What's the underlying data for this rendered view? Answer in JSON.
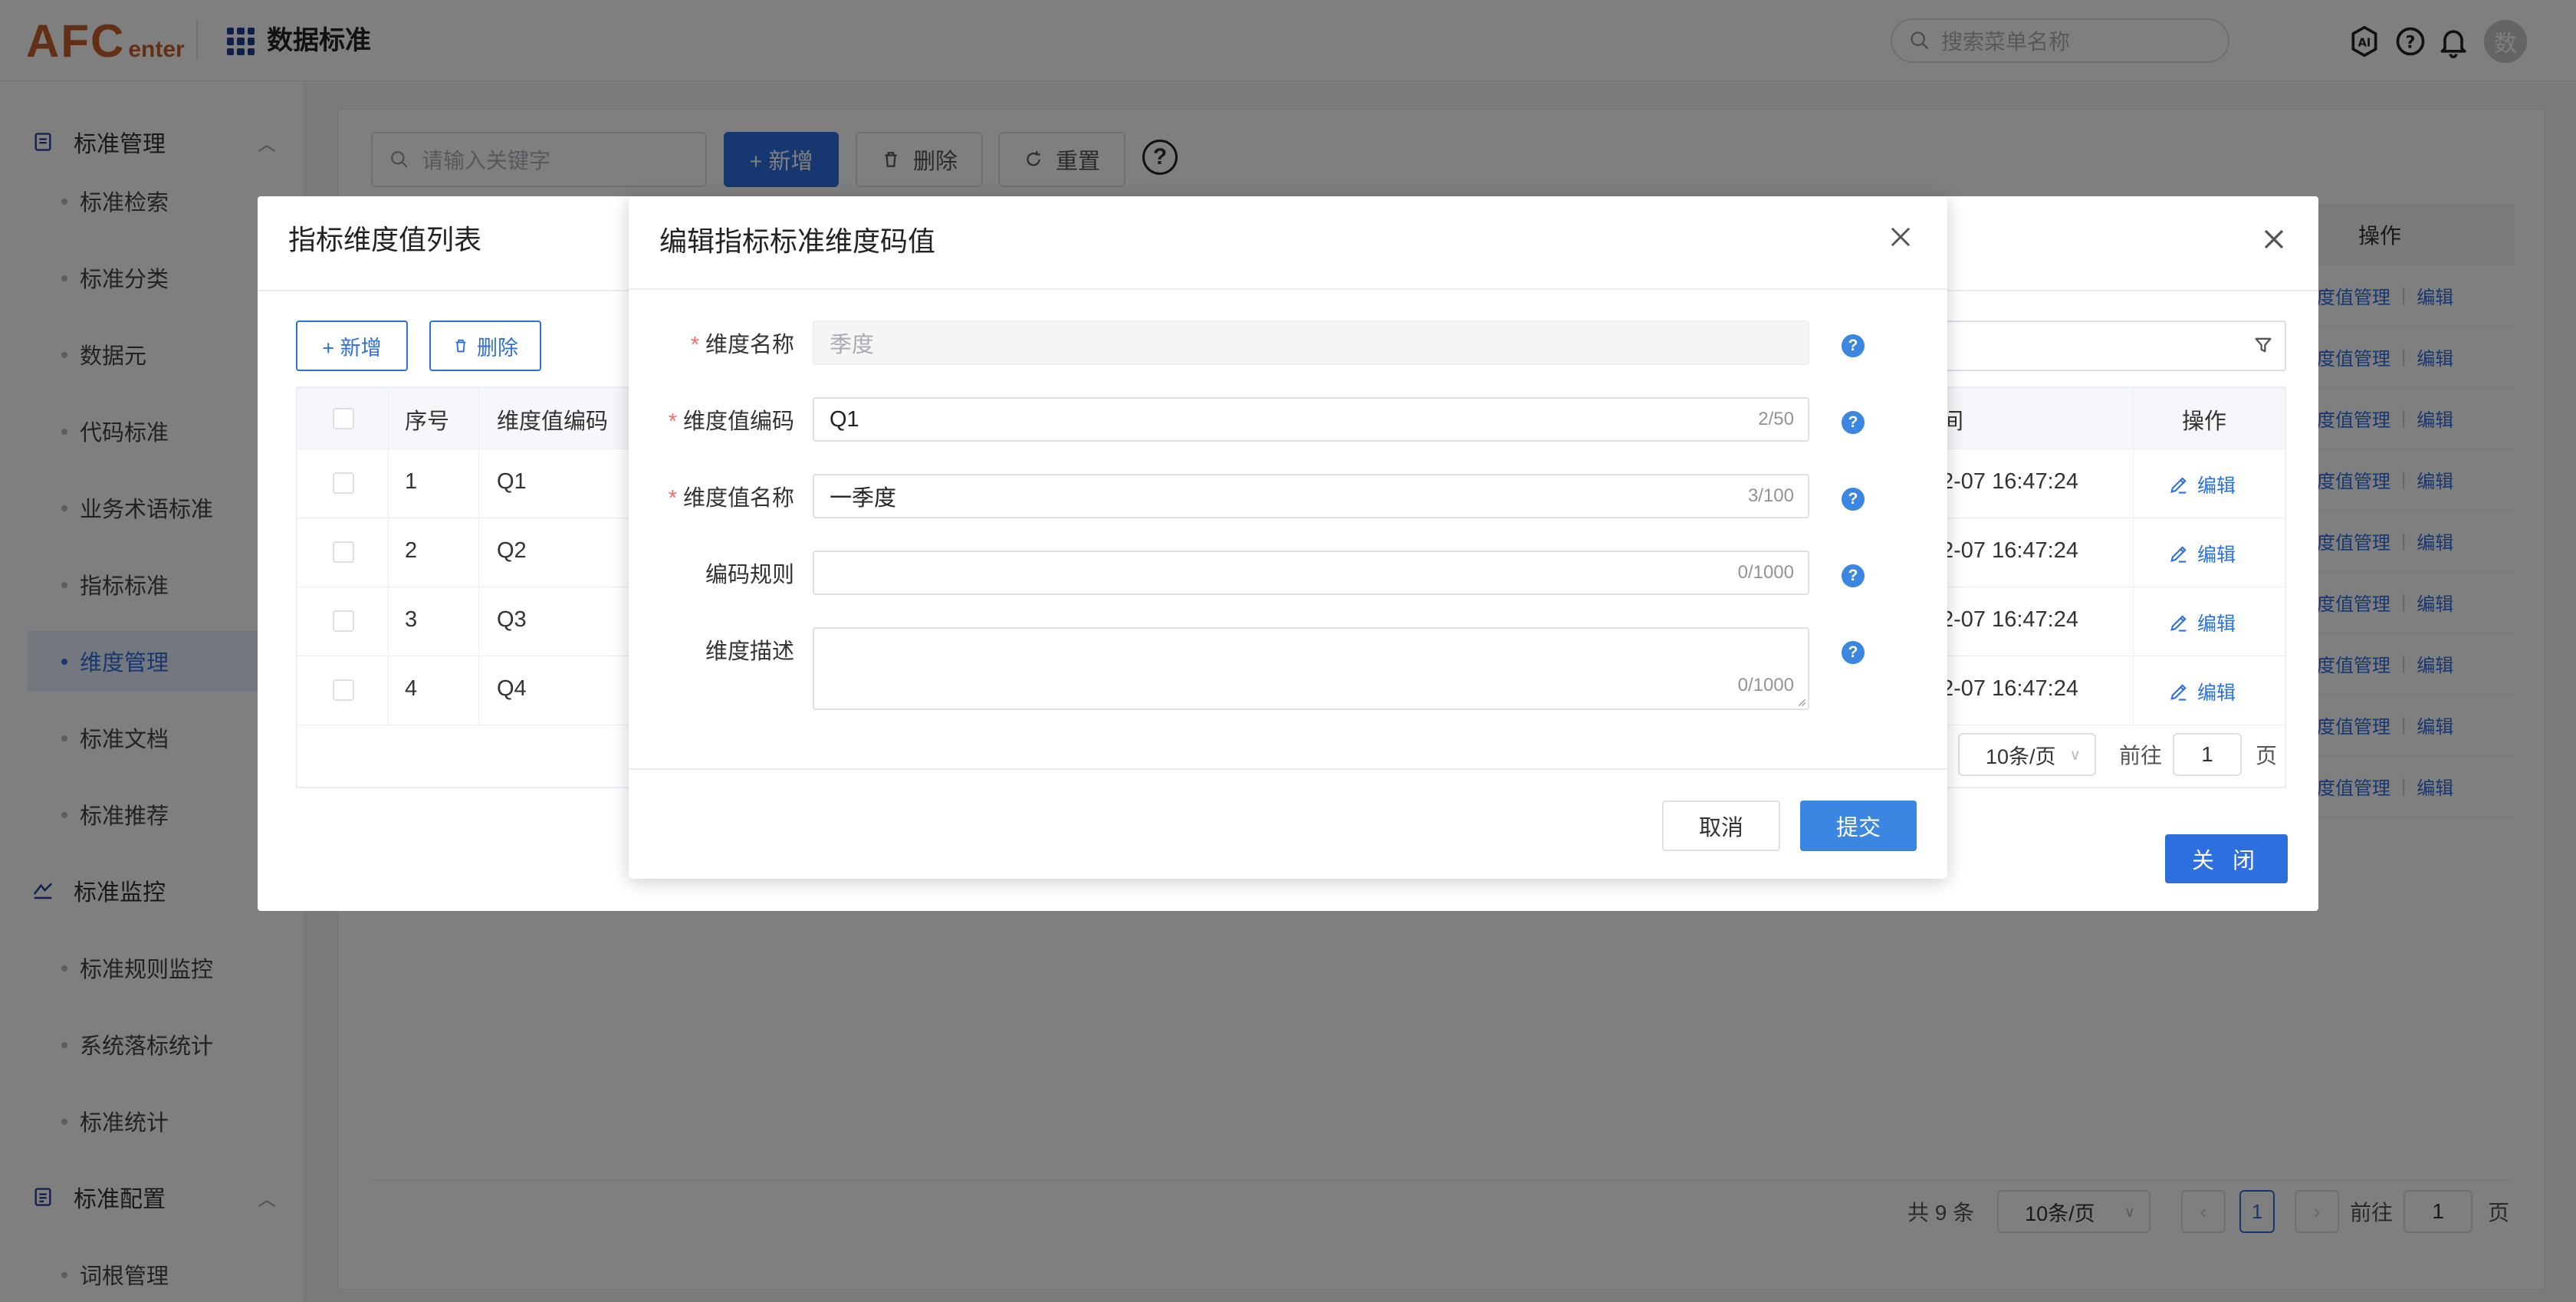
{
  "header": {
    "logo_main": "AFC",
    "logo_sub": "enter",
    "app_title": "数据标准",
    "search_placeholder": "搜索菜单名称",
    "avatar_text": "数"
  },
  "sidebar": {
    "groups": [
      {
        "label": "标准管理"
      },
      {
        "label": "标准监控"
      },
      {
        "label": "标准配置"
      }
    ],
    "items": [
      {
        "label": "标准检索"
      },
      {
        "label": "标准分类"
      },
      {
        "label": "数据元"
      },
      {
        "label": "代码标准"
      },
      {
        "label": "业务术语标准"
      },
      {
        "label": "指标标准"
      },
      {
        "label": "维度管理"
      },
      {
        "label": "标准文档"
      },
      {
        "label": "标准推荐"
      },
      {
        "label": "标准规则监控"
      },
      {
        "label": "系统落标统计"
      },
      {
        "label": "标准统计"
      },
      {
        "label": "词根管理"
      }
    ]
  },
  "main": {
    "keyword_placeholder": "请输入关键字",
    "add_label": "+ 新增",
    "delete_label": "删除",
    "reset_label": "重置",
    "help_symbol": "?",
    "table_header_action": "操作",
    "row_action_1": "度值管理",
    "row_action_2": "编辑",
    "pager": {
      "total": "共 9 条",
      "page_size": "10条/页",
      "current": "1",
      "goto_label": "前往",
      "goto_value": "1",
      "page_unit": "页"
    }
  },
  "dialog_list": {
    "title": "指标维度值列表",
    "add_label": "+ 新增",
    "delete_label": "删除",
    "columns": [
      "序号",
      "维度值编码",
      "间",
      "操作"
    ],
    "rows": [
      {
        "index": "1",
        "code": "Q1",
        "time": "2-07 16:47:24",
        "action": "编辑"
      },
      {
        "index": "2",
        "code": "Q2",
        "time": "2-07 16:47:24",
        "action": "编辑"
      },
      {
        "index": "3",
        "code": "Q3",
        "time": "2-07 16:47:24",
        "action": "编辑"
      },
      {
        "index": "4",
        "code": "Q4",
        "time": "2-07 16:47:24",
        "action": "编辑"
      }
    ],
    "pager": {
      "page_size": "10条/页",
      "goto_label": "前往",
      "goto_value": "1",
      "page_unit": "页"
    },
    "close_label": "关 闭"
  },
  "dialog_edit": {
    "title": "编辑指标标准维度码值",
    "fields": [
      {
        "label": "维度名称",
        "required": true,
        "value": "季度",
        "counter": ""
      },
      {
        "label": "维度值编码",
        "required": true,
        "value": "Q1",
        "counter": "2/50"
      },
      {
        "label": "维度值名称",
        "required": true,
        "value": "一季度",
        "counter": "3/100"
      },
      {
        "label": "编码规则",
        "required": false,
        "value": "",
        "counter": "0/1000"
      },
      {
        "label": "维度描述",
        "required": false,
        "value": "",
        "counter": "0/1000"
      }
    ],
    "required_mark": "*",
    "help_symbol": "?",
    "cancel_label": "取消",
    "submit_label": "提交"
  },
  "colors": {
    "primary": "#2d6fde",
    "logo": "#c8612b",
    "required": "#f56c6c"
  }
}
